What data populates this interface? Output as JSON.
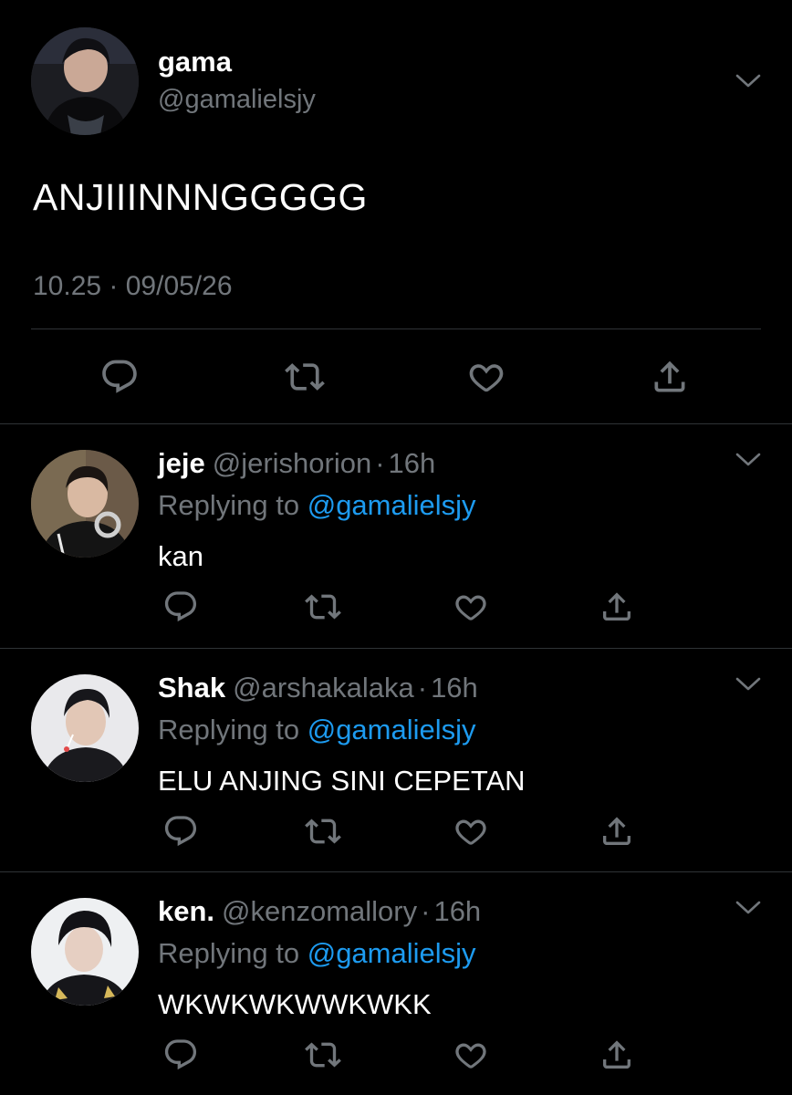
{
  "main_tweet": {
    "name": "gama",
    "handle": "@gamalielsjy",
    "text": "ANJIIINNNGGGGG",
    "timestamp": "10.25 · 09/05/26",
    "avatar": "profile-photo"
  },
  "replies": [
    {
      "name": "jeje",
      "handle": "@jerishorion",
      "dot": "·",
      "ago": "16h",
      "replying_label": "Replying to",
      "replying_to": "@gamalielsjy",
      "text": "kan",
      "avatar": "profile-photo"
    },
    {
      "name": "Shak",
      "handle": "@arshakalaka",
      "dot": "·",
      "ago": "16h",
      "replying_label": "Replying to",
      "replying_to": "@gamalielsjy",
      "text": "ELU ANJING SINI CEPETAN",
      "avatar": "profile-photo"
    },
    {
      "name": "ken.",
      "handle": "@kenzomallory",
      "dot": "·",
      "ago": "16h",
      "replying_label": "Replying to",
      "replying_to": "@gamalielsjy",
      "text": "WKWKWKWWKWKK",
      "avatar": "profile-photo"
    }
  ],
  "icons": {
    "reply": "reply-icon",
    "retweet": "retweet-icon",
    "like": "heart-icon",
    "share": "share-icon",
    "more": "chevron-down-icon"
  },
  "colors": {
    "background": "#000000",
    "text_primary": "#ffffff",
    "text_secondary": "#71767b",
    "accent": "#1d9bf0",
    "divider": "#2f3336"
  }
}
